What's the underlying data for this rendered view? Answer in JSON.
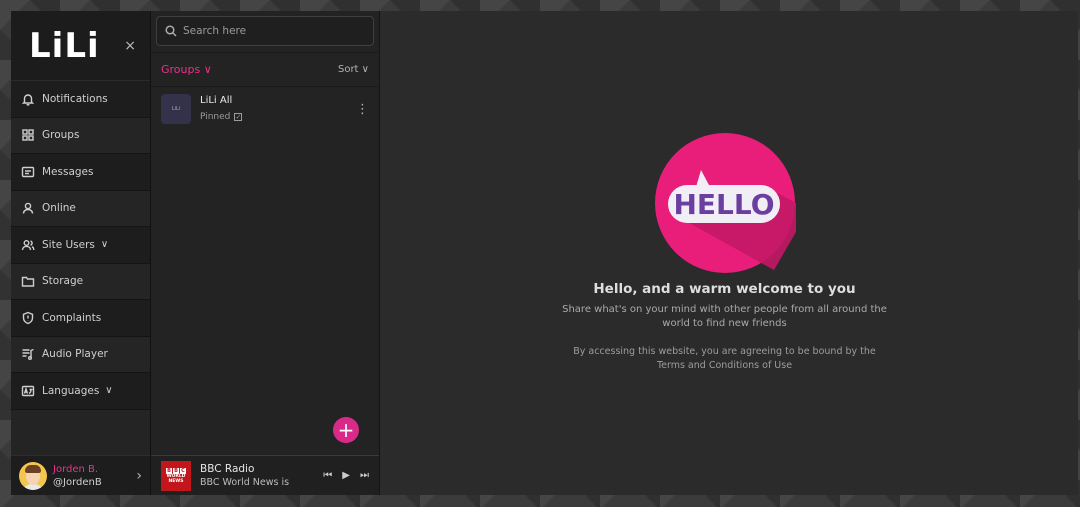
{
  "brand": {
    "logo_text": "LiLi"
  },
  "sidebar": {
    "close_glyph": "×",
    "items": [
      {
        "label": "Notifications",
        "icon": "bell-icon"
      },
      {
        "label": "Groups",
        "icon": "grid-icon"
      },
      {
        "label": "Messages",
        "icon": "message-icon"
      },
      {
        "label": "Online",
        "icon": "user-icon"
      },
      {
        "label": "Site Users",
        "icon": "users-icon",
        "has_dropdown": true
      },
      {
        "label": "Storage",
        "icon": "folder-icon"
      },
      {
        "label": "Complaints",
        "icon": "shield-icon"
      },
      {
        "label": "Audio Player",
        "icon": "music-list-icon"
      },
      {
        "label": "Languages",
        "icon": "translate-icon",
        "has_dropdown": true
      }
    ],
    "user": {
      "name": "Jorden B.",
      "handle": "@JordenB"
    }
  },
  "middle": {
    "search_placeholder": "Search here",
    "filter_label": "Groups",
    "sort_label": "Sort",
    "chats": [
      {
        "name": "LiLi All",
        "status": "Pinned",
        "thumb": "LiLi"
      }
    ],
    "fab_label": "+"
  },
  "player": {
    "logo_lines": [
      "BBC",
      "WORLD",
      "NEWS"
    ],
    "title": "BBC Radio",
    "subtitle": "BBC World News is"
  },
  "main": {
    "badge_text": "HELLO",
    "welcome_title": "Hello, and a warm welcome to you",
    "welcome_sub": "Share what's on your mind with other people from all around the world to find new friends",
    "terms": "By accessing this website, you are agreeing to be bound by the Terms and Conditions of Use"
  },
  "colors": {
    "accent": "#e7338c",
    "hello_circle": "#e91e7a",
    "hello_text": "#6b3fa0"
  }
}
